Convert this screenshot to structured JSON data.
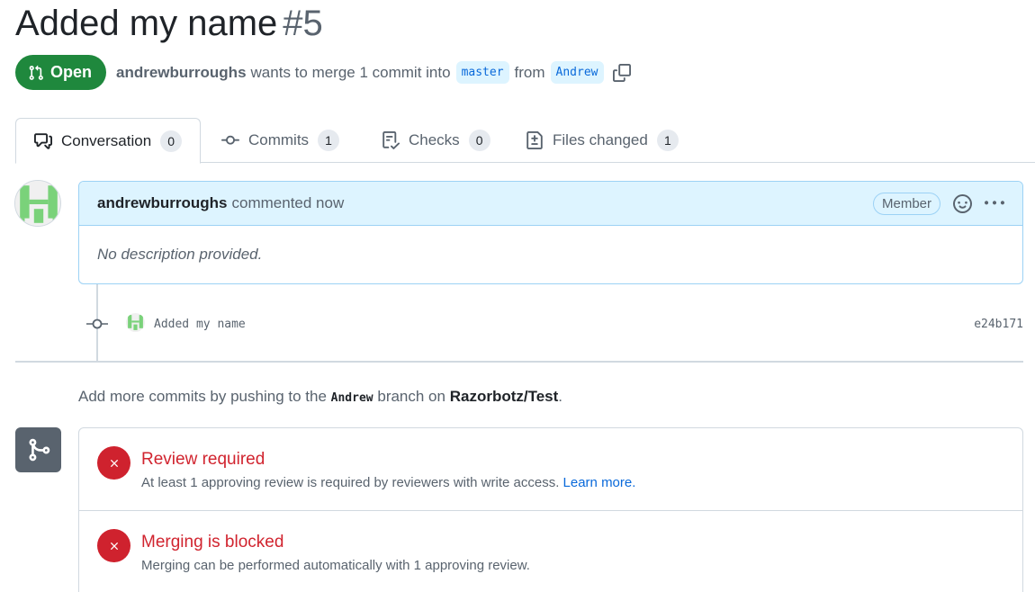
{
  "pr": {
    "title": "Added my name",
    "number": "#5",
    "state": "Open",
    "author": "andrewburroughs",
    "merge_text": "wants to merge 1 commit into",
    "base_branch": "master",
    "from_text": "from",
    "head_branch": "Andrew"
  },
  "tabs": [
    {
      "label": "Conversation",
      "count": "0",
      "icon": "comment-discussion-icon"
    },
    {
      "label": "Commits",
      "count": "1",
      "icon": "git-commit-icon"
    },
    {
      "label": "Checks",
      "count": "0",
      "icon": "checklist-icon"
    },
    {
      "label": "Files changed",
      "count": "1",
      "icon": "file-diff-icon"
    }
  ],
  "comment": {
    "author": "andrewburroughs",
    "action": "commented now",
    "role": "Member",
    "body": "No description provided."
  },
  "commit": {
    "message": "Added my name",
    "sha": "e24b171"
  },
  "hint": {
    "prefix": "Add more commits by pushing to the",
    "branch": "Andrew",
    "middle": "branch on",
    "repo": "Razorbotz/Test",
    "suffix": "."
  },
  "merge": {
    "review": {
      "title": "Review required",
      "desc": "At least 1 approving review is required by reviewers with write access.",
      "link": "Learn more."
    },
    "blocked": {
      "title": "Merging is blocked",
      "desc": "Merging can be performed automatically with 1 approving review."
    }
  },
  "colors": {
    "open_green": "#1f883d",
    "danger_red": "#cf222e",
    "accent_blue": "#0969da",
    "comment_header_bg": "#ddf4ff",
    "identicon_green": "#7ad27a"
  }
}
